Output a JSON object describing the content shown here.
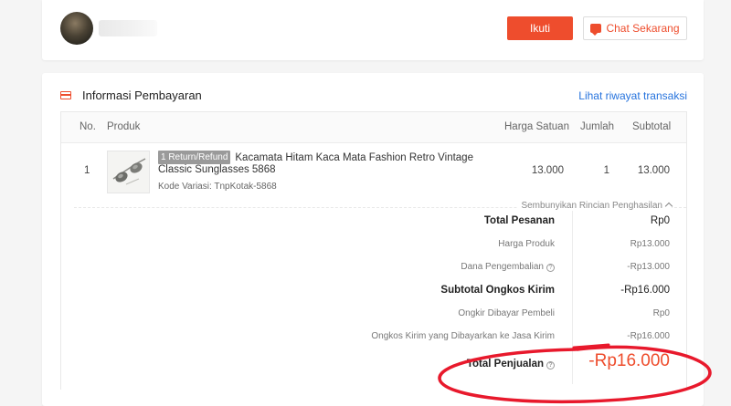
{
  "shop": {
    "follow_label": "Ikuti",
    "chat_label": "Chat Sekarang"
  },
  "payment": {
    "title": "Informasi Pembayaran",
    "history_link": "Lihat riwayat transaksi",
    "columns": {
      "no": "No.",
      "product": "Produk",
      "unit_price": "Harga Satuan",
      "qty": "Jumlah",
      "subtotal": "Subtotal"
    },
    "item": {
      "no": "1",
      "badge": "1 Return/Refund",
      "name": "Kacamata Hitam Kaca Mata Fashion Retro Vintage Classic Sunglasses 5868",
      "variant": "Kode Variasi: TnpKotak-5868",
      "unit_price": "13.000",
      "qty": "1",
      "subtotal": "13.000"
    },
    "hide_details": "Sembunyikan Rincian Penghasilan",
    "breakdown": [
      {
        "label": "Total Pesanan",
        "value": "Rp0"
      },
      {
        "label": "Harga Produk",
        "value": "Rp13.000"
      },
      {
        "label": "Dana Pengembalian",
        "value": "-Rp13.000"
      },
      {
        "label": "Subtotal Ongkos Kirim",
        "value": "-Rp16.000"
      },
      {
        "label": "Ongkir Dibayar Pembeli",
        "value": "Rp0"
      },
      {
        "label": "Ongkos Kirim yang Dibayarkan ke Jasa Kirim",
        "value": "-Rp16.000"
      }
    ],
    "total": {
      "label": "Total Penjualan",
      "value": "-Rp16.000"
    },
    "help_glyph": "?"
  },
  "colors": {
    "brand": "#ee4d2d",
    "link": "#2673dd",
    "annotation": "#e8192c"
  }
}
